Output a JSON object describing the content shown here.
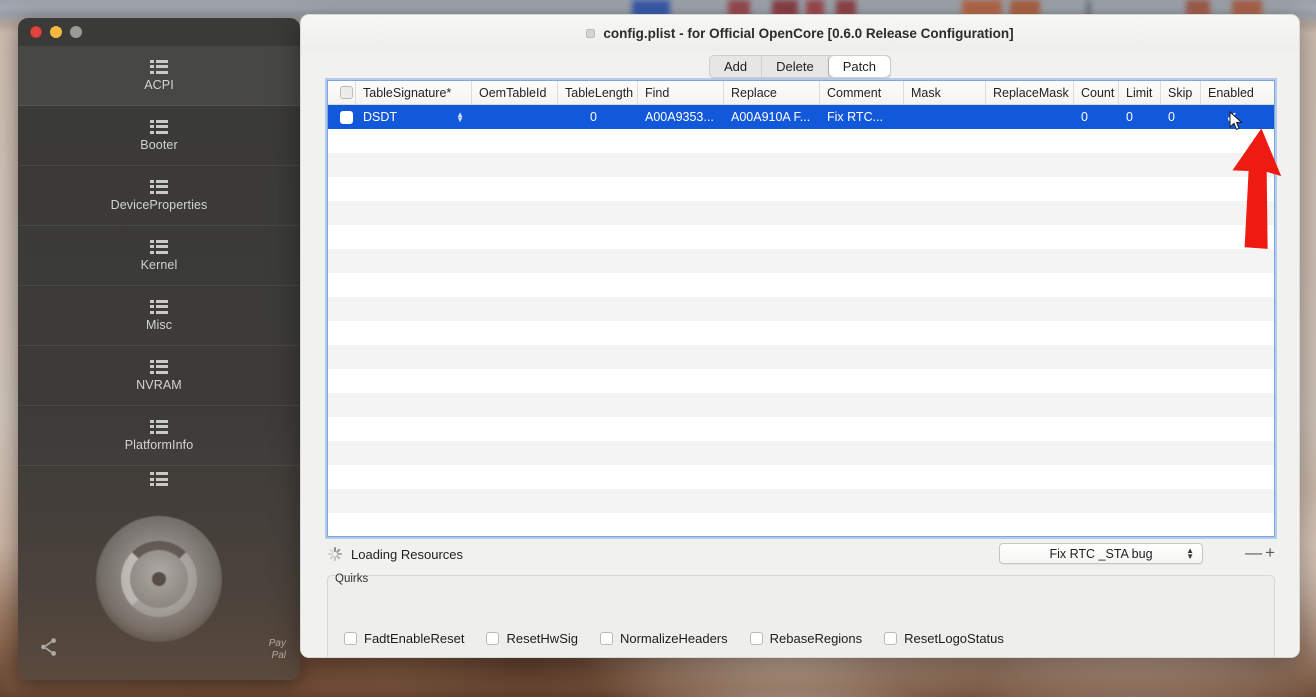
{
  "window": {
    "title": "config.plist - for Official OpenCore [0.6.0 Release Configuration]",
    "traffic_lights": [
      "close",
      "minimize",
      "zoom"
    ]
  },
  "toolbar": {
    "segments": [
      {
        "label": "Add",
        "active": false
      },
      {
        "label": "Delete",
        "active": false
      },
      {
        "label": "Patch",
        "active": true
      }
    ]
  },
  "sidebar": {
    "items": [
      {
        "label": "ACPI",
        "icon": "list-icon",
        "selected": true
      },
      {
        "label": "Booter",
        "icon": "list-icon",
        "selected": false
      },
      {
        "label": "DeviceProperties",
        "icon": "list-icon",
        "selected": false
      },
      {
        "label": "Kernel",
        "icon": "list-icon",
        "selected": false
      },
      {
        "label": "Misc",
        "icon": "list-icon",
        "selected": false
      },
      {
        "label": "NVRAM",
        "icon": "list-icon",
        "selected": false
      },
      {
        "label": "PlatformInfo",
        "icon": "list-icon",
        "selected": false
      },
      {
        "label": "",
        "icon": "list-icon",
        "selected": false
      }
    ],
    "share_icon": "share-icon",
    "paypal_text": "Pay\nPal"
  },
  "table": {
    "columns": [
      "TableSignature*",
      "OemTableId",
      "TableLength",
      "Find",
      "Replace",
      "Comment",
      "Mask",
      "ReplaceMask",
      "Count",
      "Limit",
      "Skip",
      "Enabled"
    ],
    "rows": [
      {
        "selected": true,
        "checked": false,
        "TableSignature": "DSDT",
        "OemTableId": "",
        "TableLength": "0",
        "Find": "A00A9353...",
        "Replace": "A00A910A F...",
        "Comment": "Fix RTC...",
        "Mask": "",
        "ReplaceMask": "",
        "Count": "0",
        "Limit": "0",
        "Skip": "0",
        "Enabled": "checked"
      }
    ],
    "empty_row_count": 16
  },
  "footer": {
    "loading_label": "Loading Resources",
    "preset_value": "Fix RTC _STA bug",
    "minus_label": "—",
    "plus_label": "+"
  },
  "quirks": {
    "title": "Quirks",
    "items": [
      {
        "label": "FadtEnableReset",
        "checked": false
      },
      {
        "label": "ResetHwSig",
        "checked": false
      },
      {
        "label": "NormalizeHeaders",
        "checked": false
      },
      {
        "label": "RebaseRegions",
        "checked": false
      },
      {
        "label": "ResetLogoStatus",
        "checked": false
      }
    ]
  },
  "annotations": {
    "arrow_color": "#ee1b13",
    "arrow_target": "enabled-checkbox",
    "cursor": "arrow-cursor"
  },
  "colors": {
    "selection_blue": "#1258da",
    "focus_ring": "#7aa7e0",
    "window_bg": "#f1f1ef",
    "sidebar_bg": "#3a3a38",
    "accent_red": "#ee1b13"
  }
}
